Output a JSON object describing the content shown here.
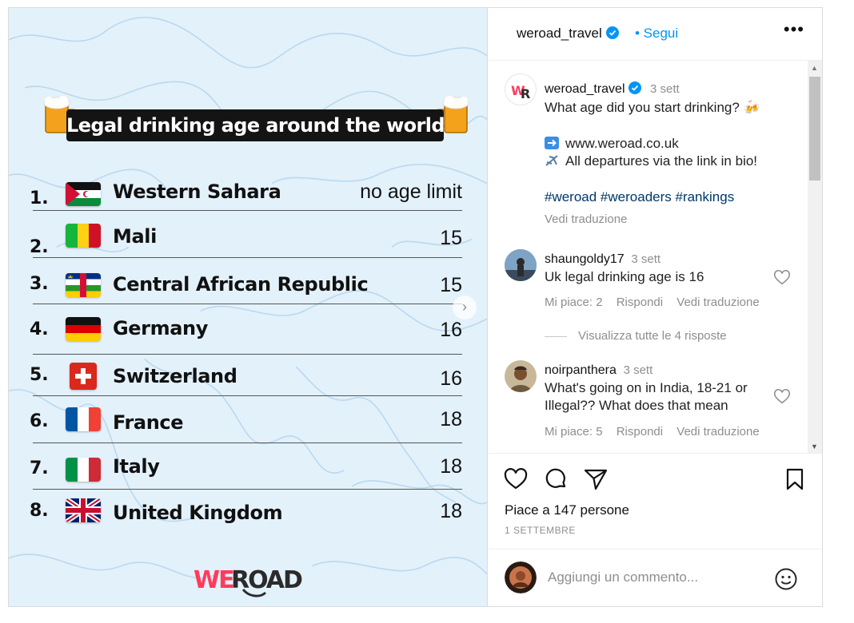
{
  "post": {
    "title": "Legal drinking age around the world",
    "rows": [
      {
        "rank": "1.",
        "country": "Western Sahara",
        "age": "no age limit"
      },
      {
        "rank": "2.",
        "country": "Mali",
        "age": "15"
      },
      {
        "rank": "3.",
        "country": "Central African Republic",
        "age": "15"
      },
      {
        "rank": "4.",
        "country": "Germany",
        "age": "16"
      },
      {
        "rank": "5.",
        "country": "Switzerland",
        "age": "16"
      },
      {
        "rank": "6.",
        "country": "France",
        "age": "18"
      },
      {
        "rank": "7.",
        "country": "Italy",
        "age": "18"
      },
      {
        "rank": "8.",
        "country": "United Kingdom",
        "age": "18"
      }
    ],
    "next_icon": "chevron-right-icon",
    "brand_colors": {
      "accent": "#ff3b5c",
      "dark": "#2b2b2b"
    }
  },
  "header": {
    "username": "weroad_travel",
    "follow": "• Segui",
    "more": "•••"
  },
  "caption": {
    "username": "weroad_travel",
    "time": "3 sett",
    "text": "What age did you start drinking? 🍻",
    "link_line": "www.weroad.co.uk",
    "bio_line": "All departures via the link in bio!",
    "hashtags": "#weroad #weroaders #rankings",
    "translate": "Vedi traduzione"
  },
  "comments": [
    {
      "username": "shaungoldy17",
      "time": "3 sett",
      "lines": [
        "Uk legal drinking age is 16"
      ],
      "likes": "Mi piace: 2",
      "reply": "Rispondi",
      "translate": "Vedi traduzione",
      "view_replies": "Visualizza tutte le 4 risposte"
    },
    {
      "username": "noirpanthera",
      "time": "3 sett",
      "lines": [
        "What's going on in India, 18-21 or",
        "Illegal?? What does that mean"
      ],
      "likes": "Mi piace: 5",
      "reply": "Rispondi",
      "translate": "Vedi traduzione"
    }
  ],
  "actions": {
    "likes": "Piace a 147 persone",
    "date": "1 SETTEMBRE"
  },
  "add_comment": {
    "placeholder": "Aggiungi un commento..."
  },
  "colors": {
    "link": "#0095f6",
    "hashtag": "#00376b",
    "muted": "#8e8e8e",
    "media_bg": "#e3f1fb"
  }
}
